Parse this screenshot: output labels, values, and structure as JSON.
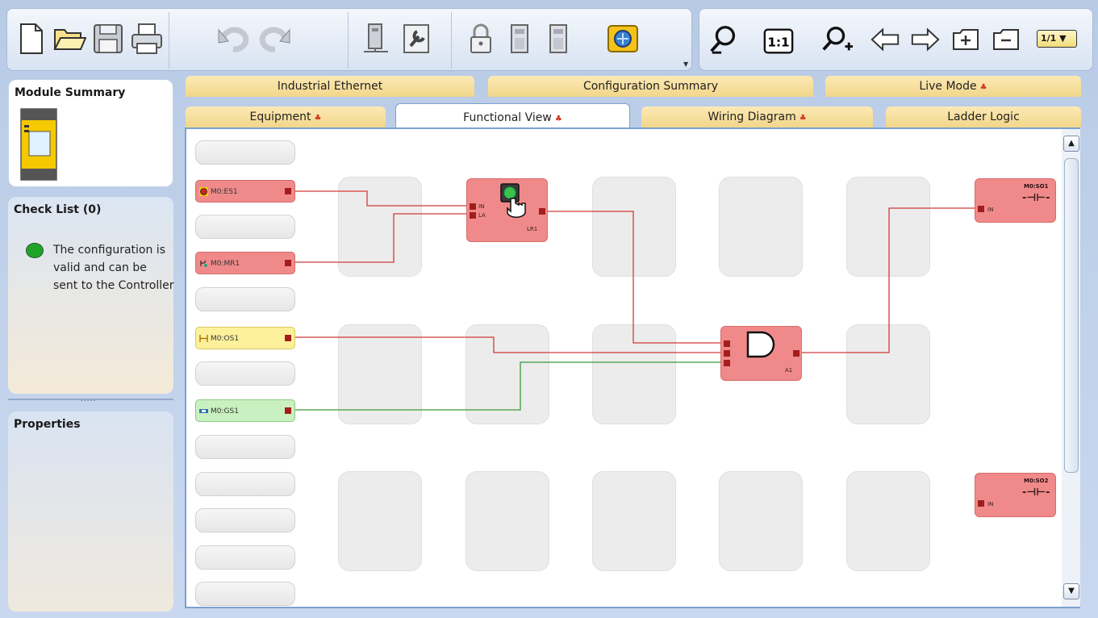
{
  "toolbar": {
    "buttons": [
      "new-file",
      "open-folder",
      "save",
      "print",
      "undo",
      "redo",
      "controller",
      "configure",
      "lock",
      "module-a",
      "module-b",
      "connect-online"
    ],
    "zoom": [
      "zoom-out",
      "zoom-1to1",
      "zoom-in",
      "arrow-left",
      "arrow-right",
      "add-page",
      "remove-page"
    ],
    "zoom_1to1_label": "1:1",
    "page_select": "1/1 ▼"
  },
  "module_summary": {
    "title": "Module Summary"
  },
  "checklist": {
    "title": "Check List (0)",
    "items": [
      {
        "status": "ok",
        "text": "The configuration is valid and can be sent to the Controller"
      }
    ]
  },
  "properties": {
    "title": "Properties"
  },
  "splitter_dots": ".....",
  "tabs_row1": [
    "Industrial Ethernet",
    "Configuration Summary",
    "Live Mode"
  ],
  "tabs_row2": [
    "Equipment",
    "Functional View",
    "Wiring Diagram",
    "Ladder Logic"
  ],
  "active_tab": "Functional View",
  "tab_flag": "♣",
  "canvas": {
    "inputs": [
      "M0:ES1",
      "M0:MR1",
      "M0:OS1",
      "M0:GS1"
    ],
    "logic_blocks": {
      "lr1": {
        "label": "LR1",
        "ports": [
          "IN",
          "LA"
        ]
      },
      "a1": {
        "label": "A1"
      }
    },
    "outputs": [
      {
        "title": "M0:SO1",
        "port": "IN",
        "symbol": "-⊣⊢-"
      },
      {
        "title": "M0:SO2",
        "port": "IN",
        "symbol": "-⊣⊢-"
      }
    ]
  },
  "colors": {
    "input_red": "#f08a8a",
    "input_yellow": "#fcf19a",
    "input_green": "#c9f0c0",
    "wire_red": "#d13a3a",
    "wire_green": "#3a9a3a",
    "tab_gold": "#f2d68a",
    "active_blue": "#7ea0d1"
  },
  "scrollbar": {
    "up": "▲",
    "down": "▼"
  }
}
